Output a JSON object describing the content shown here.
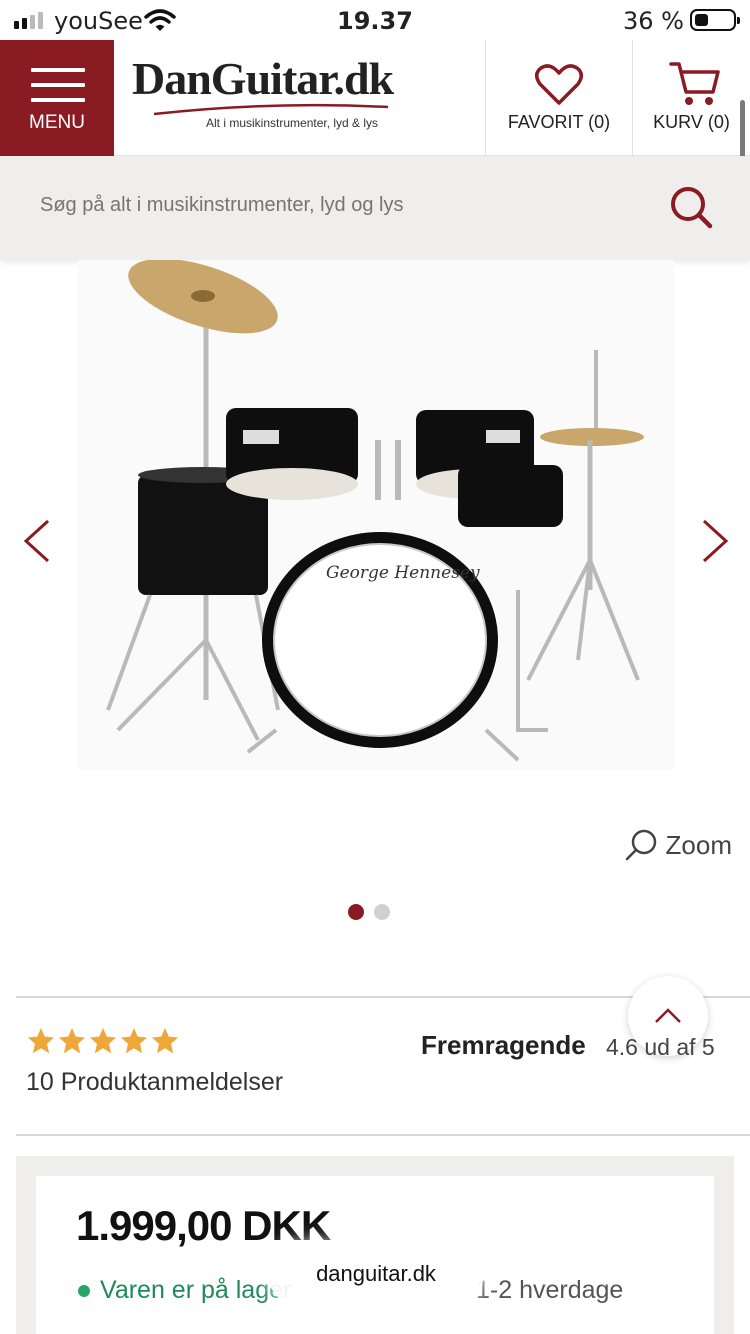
{
  "status_bar": {
    "carrier": "youSee",
    "time": "19.37",
    "battery": "36 %"
  },
  "header": {
    "menu_label": "MENU",
    "logo_text": "DanGuitar.dk",
    "logo_tagline": "Alt i musikinstrumenter, lyd & lys",
    "favorites_label": "FAVORIT (0)",
    "cart_label": "KURV (0)"
  },
  "search": {
    "placeholder": "Søg på alt i musikinstrumenter, lyd og lys"
  },
  "gallery": {
    "drum_brand_text": "George Hennesey",
    "zoom_label": "Zoom",
    "dots_total": 2,
    "dots_active": 1
  },
  "rating": {
    "stars": 5,
    "review_count": "10 Produktanmeldelser",
    "rating_word": "Fremragende",
    "rating_score": "4.6 ud af 5"
  },
  "purchase": {
    "price": "1.999,00 DKK",
    "stock_status": "Varen er på lager",
    "delivery": "1-2 hverdage"
  },
  "browser": {
    "url": "danguitar.dk"
  },
  "colors": {
    "brand": "#8b1b23",
    "star": "#f0a73a",
    "in_stock": "#1e8a5a",
    "panel_bg": "#efeeec"
  }
}
